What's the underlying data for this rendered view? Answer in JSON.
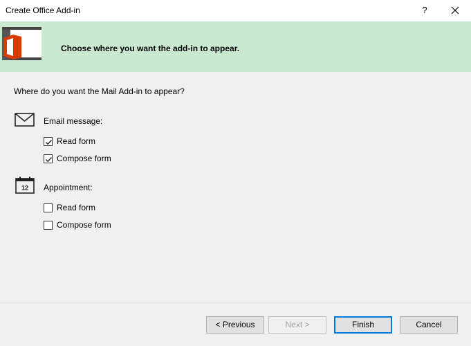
{
  "window": {
    "title": "Create Office Add-in",
    "help_label": "?"
  },
  "banner": {
    "heading": "Choose where you want the add-in to appear.",
    "logo_icon": "office-logo-icon",
    "brand_color": "#d83b01"
  },
  "main": {
    "question": "Where do you want the Mail Add-in to appear?",
    "groups": [
      {
        "label": "Email message:",
        "icon": "envelope-icon",
        "options": [
          {
            "label": "Read form",
            "checked": true
          },
          {
            "label": "Compose form",
            "checked": true
          }
        ]
      },
      {
        "label": "Appointment:",
        "icon": "calendar-icon",
        "icon_text": "12",
        "options": [
          {
            "label": "Read form",
            "checked": false
          },
          {
            "label": "Compose form",
            "checked": false
          }
        ]
      }
    ]
  },
  "footer": {
    "previous_label": "< Previous",
    "next_label": "Next >",
    "finish_label": "Finish",
    "cancel_label": "Cancel",
    "next_enabled": false,
    "accent_color": "#0078d7"
  }
}
